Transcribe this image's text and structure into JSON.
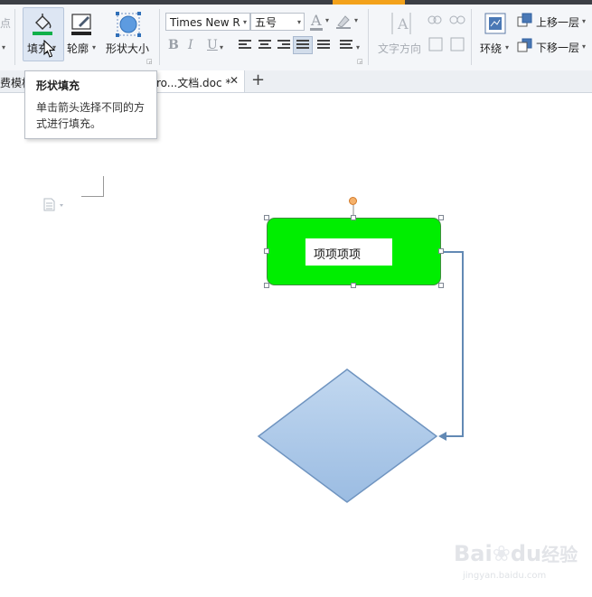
{
  "ribbon": {
    "left_cut_label": "点",
    "fill_label": "填充",
    "outline_label": "轮廓",
    "shape_size_label": "形状大小",
    "font_name": "Times New R",
    "font_size": "五号",
    "bold": "B",
    "italic": "I",
    "underline": "U",
    "text_direction_label": "文字方向",
    "wrap_label": "环绕",
    "bring_forward_label": "上移一层",
    "send_backward_label": "下移一层"
  },
  "tabs": {
    "left_tab": "费模板",
    "doc_tab": "ro...文档.doc *",
    "close": "✕",
    "add": "+"
  },
  "tooltip": {
    "title": "形状填充",
    "body_line1": "单击箭头选择不同的方",
    "body_line2": "式进行填充。"
  },
  "document": {
    "rect_text": "项项项项",
    "rect_fill": "#00ee00",
    "diamond_fill": "#a9c5e6"
  },
  "watermark": {
    "brand": "Bai",
    "brand2": "du",
    "brand_cn": "经验",
    "url": "jingyan.baidu.com"
  }
}
